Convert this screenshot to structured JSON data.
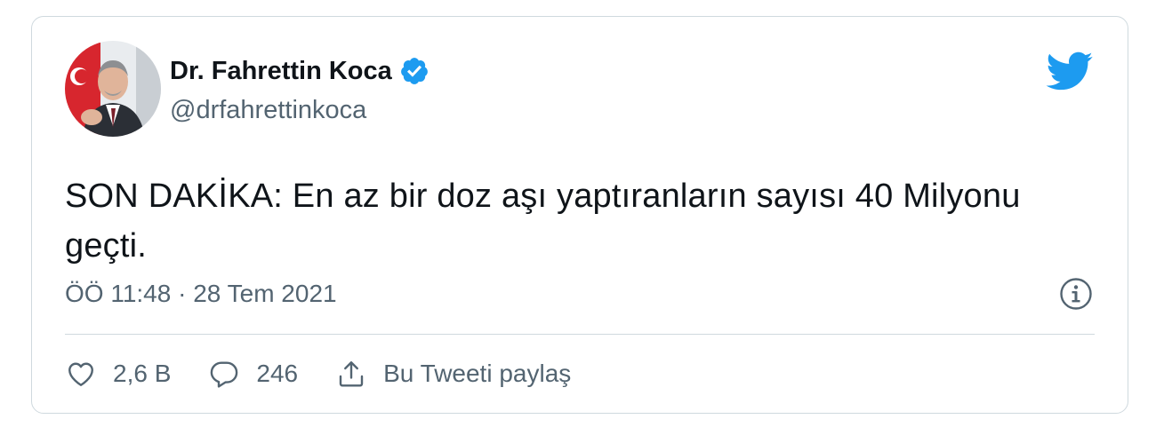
{
  "tweet": {
    "author_name": "Dr. Fahrettin Koca",
    "author_handle": "@drfahrettinkoca",
    "text": "SON DAKİKA: En az bir doz aşı yaptıranların sayısı 40 Milyonu geçti.",
    "timestamp": "ÖÖ 11:48 · 28 Tem 2021",
    "likes": "2,6 B",
    "replies": "246",
    "share_label": "Bu Tweeti paylaş"
  },
  "icons": {
    "verified": "verified-badge-icon",
    "brand": "twitter-bird-icon",
    "info": "info-icon",
    "like": "heart-icon",
    "reply": "reply-bubble-icon",
    "share": "share-icon"
  },
  "colors": {
    "brand": "#1d9bf0",
    "text": "#0f1419",
    "secondary": "#536471",
    "border": "#cfd9de"
  }
}
